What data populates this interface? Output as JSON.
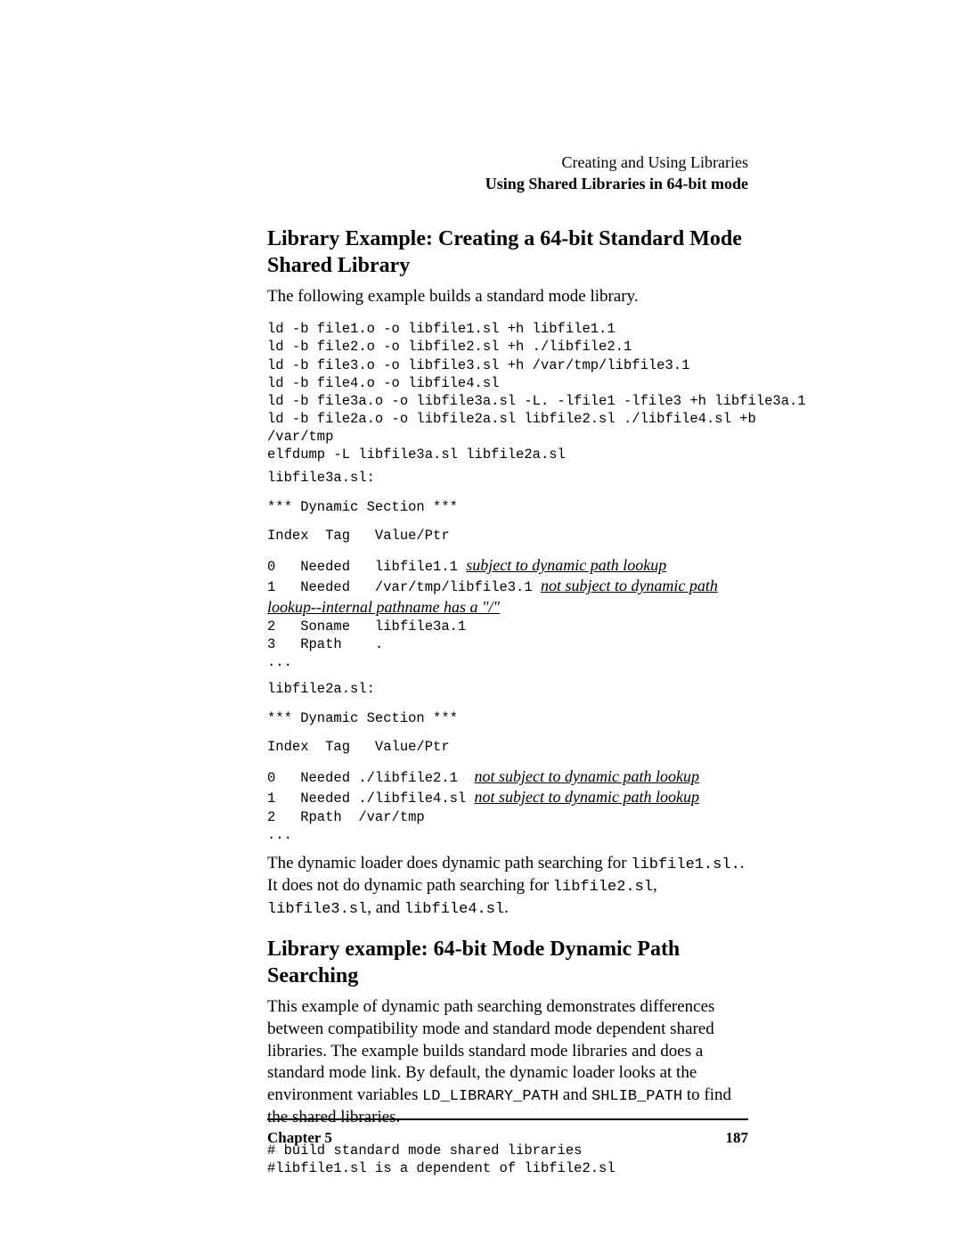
{
  "running_head": {
    "line1": "Creating and Using Libraries",
    "line2": "Using Shared Libraries in 64-bit mode"
  },
  "section1": {
    "title": "Library Example: Creating a 64-bit Standard Mode Shared Library",
    "intro": "The following example builds a standard mode library.",
    "code1": "ld -b file1.o -o libfile1.sl +h libfile1.1\nld -b file2.o -o libfile2.sl +h ./libfile2.1\nld -b file3.o -o libfile3.sl +h /var/tmp/libfile3.1\nld -b file4.o -o libfile4.sl\nld -b file3a.o -o libfile3a.sl -L. -lfile1 -lfile3 +h libfile3a.1\nld -b file2a.o -o libfile2a.sl libfile2.sl ./libfile4.sl +b\n/var/tmp\nelfdump -L libfile3a.sl libfile2a.sl",
    "block_a_header": "libfile3a.sl:",
    "dyn_section": "*** Dynamic Section ***",
    "index_header": "Index  Tag   Value/Ptr",
    "a_row0_pre": "0   Needed   libfile1.1 ",
    "a_row0_annot": "subject to dynamic path lookup",
    "a_row1_pre": "1   Needed   /var/tmp/libfile3.1 ",
    "a_row1_annot": "not subject to dynamic path ",
    "a_row1_annot2": "lookup--internal pathname has a \"/\"",
    "a_rest": "2   Soname   libfile3a.1\n3   Rpath    .\n...",
    "block_b_header": "libfile2a.sl:",
    "b_row0_pre": "0   Needed ./libfile2.1  ",
    "b_row0_annot": "not subject to dynamic path lookup",
    "b_row1_pre": "1   Needed ./libfile4.sl ",
    "b_row1_annot": "not subject to dynamic path lookup",
    "b_rest": "2   Rpath  /var/tmp\n...",
    "para_after_pre1": "The dynamic loader does dynamic path searching for ",
    "para_after_mono1": "libfile1.sl.",
    "para_after_mid1": ". It does not do dynamic path searching for ",
    "para_after_mono2": "libfile2.sl",
    "para_after_sep": ", ",
    "para_after_mono3": "libfile3.sl",
    "para_after_mid2": ", and ",
    "para_after_mono4": "libfile4.sl",
    "para_after_end": "."
  },
  "section2": {
    "title": "Library example: 64-bit Mode Dynamic Path Searching",
    "para_pre": "This example of dynamic path searching demonstrates differences between compatibility mode and standard mode dependent shared libraries. The example builds standard mode libraries and does a standard mode link. By default, the dynamic loader looks at the environment variables ",
    "mono1": "LD_LIBRARY_PATH",
    "mid": " and ",
    "mono2": "SHLIB_PATH",
    "para_post": " to find the shared libraries.",
    "code": "# build standard mode shared libraries\n#libfile1.sl is a dependent of libfile2.sl"
  },
  "footer": {
    "left": "Chapter 5",
    "right": "187"
  }
}
